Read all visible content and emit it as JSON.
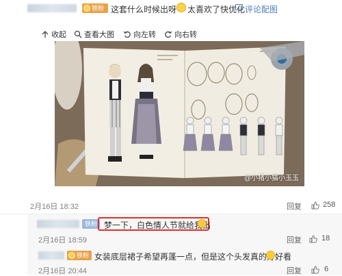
{
  "comment_top": {
    "badge": "铁粉",
    "text": "这套什么时候出呀",
    "text2": "太喜欢了快优化",
    "emoji_face": "laugh-emoji-icon",
    "reply_with_image": "评论配图"
  },
  "toolbar": {
    "collapse": "收起",
    "view_large": "查看大图",
    "rotate_left": "向左转",
    "rotate_right": "向右转"
  },
  "image": {
    "watermark": "@小猪小猫小玉玉"
  },
  "post_meta": {
    "date": "2月16日 18:32",
    "reply": "回复",
    "likes": "258"
  },
  "reply1": {
    "badge": "铁粉",
    "text": "梦一下，白色情人节就给我出",
    "date": "2月16日 18:59",
    "likes": "18"
  },
  "reply2": {
    "badge": "铁粉",
    "text": "女装底层裙子希望再蓬一点，但是这个头发真的好好看",
    "date": "2月16日 20:44",
    "likes": "6"
  },
  "labels": {
    "reply": "回复"
  },
  "colors": {
    "link": "#4d7fbf",
    "badge_gold": "#e8a24a",
    "badge_blue": "#9ab8de",
    "highlight_border": "#e0302c"
  }
}
